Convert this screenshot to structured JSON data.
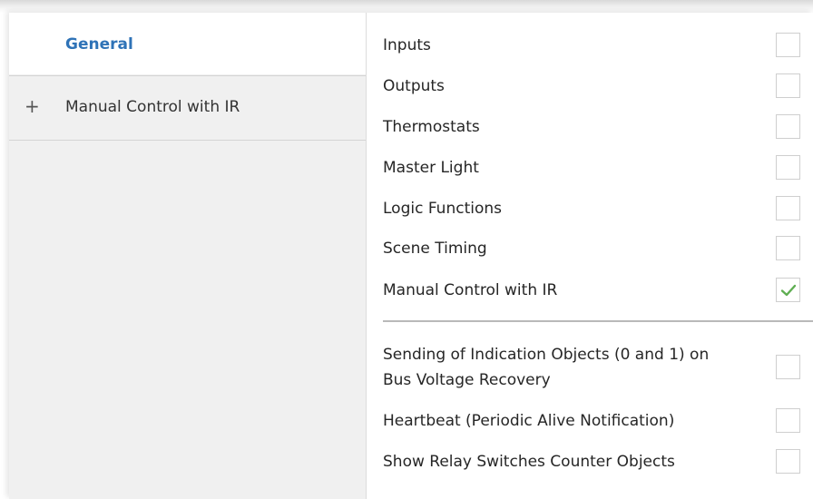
{
  "sidebar": {
    "items": [
      {
        "label": "General",
        "selected": true
      },
      {
        "label": "Manual Control with IR",
        "expand_symbol": "+"
      }
    ]
  },
  "modules": [
    {
      "label": "Inputs",
      "checked": false
    },
    {
      "label": "Outputs",
      "checked": false
    },
    {
      "label": "Thermostats",
      "checked": false
    },
    {
      "label": "Master Light",
      "checked": false
    },
    {
      "label": "Logic Functions",
      "checked": false
    },
    {
      "label": "Scene Timing",
      "checked": false
    },
    {
      "label": "Manual Control with IR",
      "checked": true
    }
  ],
  "options": [
    {
      "label_line1": "Sending of Indication Objects (0 and 1) on",
      "label_line2": "Bus Voltage Recovery",
      "checked": false
    },
    {
      "label": "Heartbeat (Periodic Alive Notification)",
      "checked": false
    },
    {
      "label": "Show Relay Switches Counter Objects",
      "checked": false
    }
  ],
  "colors": {
    "accent": "#2f73b7",
    "check": "#5fae52",
    "sidebar_bg": "#f0f0f0"
  }
}
